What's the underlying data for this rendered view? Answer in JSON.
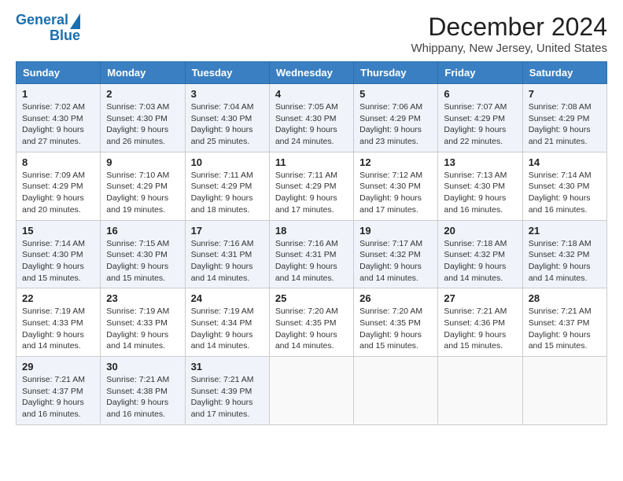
{
  "header": {
    "logo_line1": "General",
    "logo_line2": "Blue",
    "title": "December 2024",
    "subtitle": "Whippany, New Jersey, United States"
  },
  "days_of_week": [
    "Sunday",
    "Monday",
    "Tuesday",
    "Wednesday",
    "Thursday",
    "Friday",
    "Saturday"
  ],
  "weeks": [
    [
      {
        "day": 1,
        "rise": "Sunrise: 7:02 AM",
        "set": "Sunset: 4:30 PM",
        "daylight": "Daylight: 9 hours and 27 minutes."
      },
      {
        "day": 2,
        "rise": "Sunrise: 7:03 AM",
        "set": "Sunset: 4:30 PM",
        "daylight": "Daylight: 9 hours and 26 minutes."
      },
      {
        "day": 3,
        "rise": "Sunrise: 7:04 AM",
        "set": "Sunset: 4:30 PM",
        "daylight": "Daylight: 9 hours and 25 minutes."
      },
      {
        "day": 4,
        "rise": "Sunrise: 7:05 AM",
        "set": "Sunset: 4:30 PM",
        "daylight": "Daylight: 9 hours and 24 minutes."
      },
      {
        "day": 5,
        "rise": "Sunrise: 7:06 AM",
        "set": "Sunset: 4:29 PM",
        "daylight": "Daylight: 9 hours and 23 minutes."
      },
      {
        "day": 6,
        "rise": "Sunrise: 7:07 AM",
        "set": "Sunset: 4:29 PM",
        "daylight": "Daylight: 9 hours and 22 minutes."
      },
      {
        "day": 7,
        "rise": "Sunrise: 7:08 AM",
        "set": "Sunset: 4:29 PM",
        "daylight": "Daylight: 9 hours and 21 minutes."
      }
    ],
    [
      {
        "day": 8,
        "rise": "Sunrise: 7:09 AM",
        "set": "Sunset: 4:29 PM",
        "daylight": "Daylight: 9 hours and 20 minutes."
      },
      {
        "day": 9,
        "rise": "Sunrise: 7:10 AM",
        "set": "Sunset: 4:29 PM",
        "daylight": "Daylight: 9 hours and 19 minutes."
      },
      {
        "day": 10,
        "rise": "Sunrise: 7:11 AM",
        "set": "Sunset: 4:29 PM",
        "daylight": "Daylight: 9 hours and 18 minutes."
      },
      {
        "day": 11,
        "rise": "Sunrise: 7:11 AM",
        "set": "Sunset: 4:29 PM",
        "daylight": "Daylight: 9 hours and 17 minutes."
      },
      {
        "day": 12,
        "rise": "Sunrise: 7:12 AM",
        "set": "Sunset: 4:30 PM",
        "daylight": "Daylight: 9 hours and 17 minutes."
      },
      {
        "day": 13,
        "rise": "Sunrise: 7:13 AM",
        "set": "Sunset: 4:30 PM",
        "daylight": "Daylight: 9 hours and 16 minutes."
      },
      {
        "day": 14,
        "rise": "Sunrise: 7:14 AM",
        "set": "Sunset: 4:30 PM",
        "daylight": "Daylight: 9 hours and 16 minutes."
      }
    ],
    [
      {
        "day": 15,
        "rise": "Sunrise: 7:14 AM",
        "set": "Sunset: 4:30 PM",
        "daylight": "Daylight: 9 hours and 15 minutes."
      },
      {
        "day": 16,
        "rise": "Sunrise: 7:15 AM",
        "set": "Sunset: 4:30 PM",
        "daylight": "Daylight: 9 hours and 15 minutes."
      },
      {
        "day": 17,
        "rise": "Sunrise: 7:16 AM",
        "set": "Sunset: 4:31 PM",
        "daylight": "Daylight: 9 hours and 14 minutes."
      },
      {
        "day": 18,
        "rise": "Sunrise: 7:16 AM",
        "set": "Sunset: 4:31 PM",
        "daylight": "Daylight: 9 hours and 14 minutes."
      },
      {
        "day": 19,
        "rise": "Sunrise: 7:17 AM",
        "set": "Sunset: 4:32 PM",
        "daylight": "Daylight: 9 hours and 14 minutes."
      },
      {
        "day": 20,
        "rise": "Sunrise: 7:18 AM",
        "set": "Sunset: 4:32 PM",
        "daylight": "Daylight: 9 hours and 14 minutes."
      },
      {
        "day": 21,
        "rise": "Sunrise: 7:18 AM",
        "set": "Sunset: 4:32 PM",
        "daylight": "Daylight: 9 hours and 14 minutes."
      }
    ],
    [
      {
        "day": 22,
        "rise": "Sunrise: 7:19 AM",
        "set": "Sunset: 4:33 PM",
        "daylight": "Daylight: 9 hours and 14 minutes."
      },
      {
        "day": 23,
        "rise": "Sunrise: 7:19 AM",
        "set": "Sunset: 4:33 PM",
        "daylight": "Daylight: 9 hours and 14 minutes."
      },
      {
        "day": 24,
        "rise": "Sunrise: 7:19 AM",
        "set": "Sunset: 4:34 PM",
        "daylight": "Daylight: 9 hours and 14 minutes."
      },
      {
        "day": 25,
        "rise": "Sunrise: 7:20 AM",
        "set": "Sunset: 4:35 PM",
        "daylight": "Daylight: 9 hours and 14 minutes."
      },
      {
        "day": 26,
        "rise": "Sunrise: 7:20 AM",
        "set": "Sunset: 4:35 PM",
        "daylight": "Daylight: 9 hours and 15 minutes."
      },
      {
        "day": 27,
        "rise": "Sunrise: 7:21 AM",
        "set": "Sunset: 4:36 PM",
        "daylight": "Daylight: 9 hours and 15 minutes."
      },
      {
        "day": 28,
        "rise": "Sunrise: 7:21 AM",
        "set": "Sunset: 4:37 PM",
        "daylight": "Daylight: 9 hours and 15 minutes."
      }
    ],
    [
      {
        "day": 29,
        "rise": "Sunrise: 7:21 AM",
        "set": "Sunset: 4:37 PM",
        "daylight": "Daylight: 9 hours and 16 minutes."
      },
      {
        "day": 30,
        "rise": "Sunrise: 7:21 AM",
        "set": "Sunset: 4:38 PM",
        "daylight": "Daylight: 9 hours and 16 minutes."
      },
      {
        "day": 31,
        "rise": "Sunrise: 7:21 AM",
        "set": "Sunset: 4:39 PM",
        "daylight": "Daylight: 9 hours and 17 minutes."
      },
      null,
      null,
      null,
      null
    ]
  ]
}
